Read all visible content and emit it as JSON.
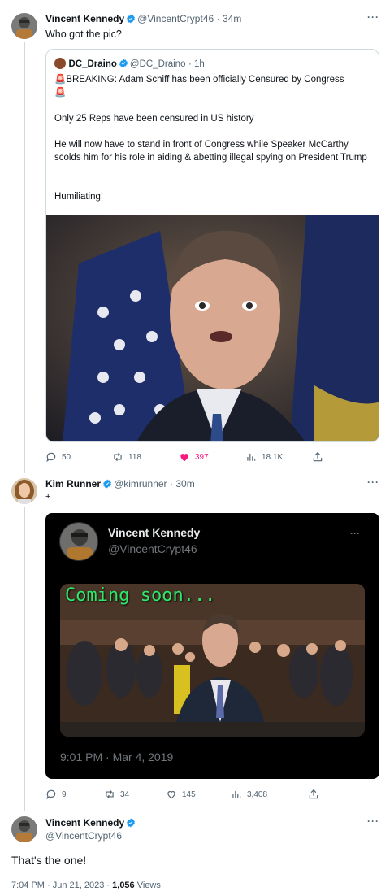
{
  "tweet1": {
    "name": "Vincent Kennedy",
    "handle": "@VincentCrypt46",
    "time": "· 34m",
    "text": "Who got the pic?",
    "more": "···",
    "quote": {
      "name": "DC_Draino",
      "handle": "@DC_Draino",
      "time": "· 1h",
      "line1": "🚨BREAKING: Adam Schiff has been officially Censured by Congress",
      "line1b": "🚨",
      "line2": "Only 25 Reps have been censured in US history",
      "line3": "He will now have to stand in front of Congress while Speaker McCarthy scolds him for his role in aiding & abetting illegal spying on President Trump",
      "line4": "Humiliating!"
    },
    "actions": {
      "replies": "50",
      "retweets": "118",
      "likes": "397",
      "views": "18.1K"
    }
  },
  "tweet2": {
    "name": "Kim Runner",
    "handle": "@kimrunner",
    "time": "· 30m",
    "text": "+",
    "more": "···",
    "card": {
      "name": "Vincent Kennedy",
      "handle": "@VincentCrypt46",
      "more": "···",
      "overlay": "Coming soon...",
      "date": "9:01 PM · Mar 4, 2019"
    },
    "actions": {
      "replies": "9",
      "retweets": "34",
      "likes": "145",
      "views": "3,408"
    }
  },
  "tweet3": {
    "name": "Vincent Kennedy",
    "handle": "@VincentCrypt46",
    "more": "···",
    "text": "That's the one!",
    "meta_time": "7:04 PM · Jun 21, 2023 · ",
    "views_count": "1,056",
    "views_label": " Views"
  },
  "colors": {
    "verified": "#1d9bf0",
    "like_active": "#f91880",
    "text_secondary": "#536471",
    "border": "#cfd9de"
  }
}
